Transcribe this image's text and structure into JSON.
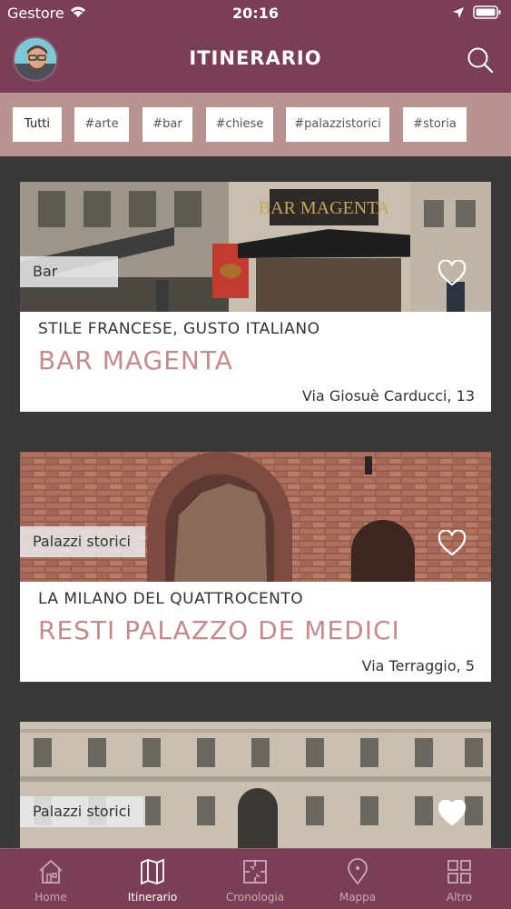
{
  "status_bar": {
    "carrier": "Gestore",
    "time": "20:16"
  },
  "header": {
    "title": "ITINERARIO"
  },
  "tags": [
    "Tutti",
    "#arte",
    "#bar",
    "#chiese",
    "#palazzistorici",
    "#storia"
  ],
  "cards": [
    {
      "category": "Bar",
      "subtitle": "STILE FRANCESE, GUSTO ITALIANO",
      "title": "BAR MAGENTA",
      "address": "Via Giosuè Carducci, 13",
      "sign_text": "BAR MAGENTA",
      "favorited": false
    },
    {
      "category": "Palazzi storici",
      "subtitle": "LA MILANO DEL QUATTROCENTO",
      "title": "RESTI PALAZZO DE MEDICI",
      "address": "Via Terraggio, 5",
      "favorited": false
    },
    {
      "category": "Palazzi storici",
      "favorited": true
    }
  ],
  "tabs": [
    {
      "label": "Home",
      "icon": "home-icon"
    },
    {
      "label": "Itinerario",
      "icon": "map-icon",
      "active": true
    },
    {
      "label": "Cronologia",
      "icon": "timeline-icon"
    },
    {
      "label": "Mappa",
      "icon": "pin-icon"
    },
    {
      "label": "Altro",
      "icon": "grid-icon"
    }
  ],
  "colors": {
    "primary": "#7a3f56",
    "tag_bar": "#b9938f",
    "title_accent": "#c48a8c",
    "background": "#3a3839"
  }
}
